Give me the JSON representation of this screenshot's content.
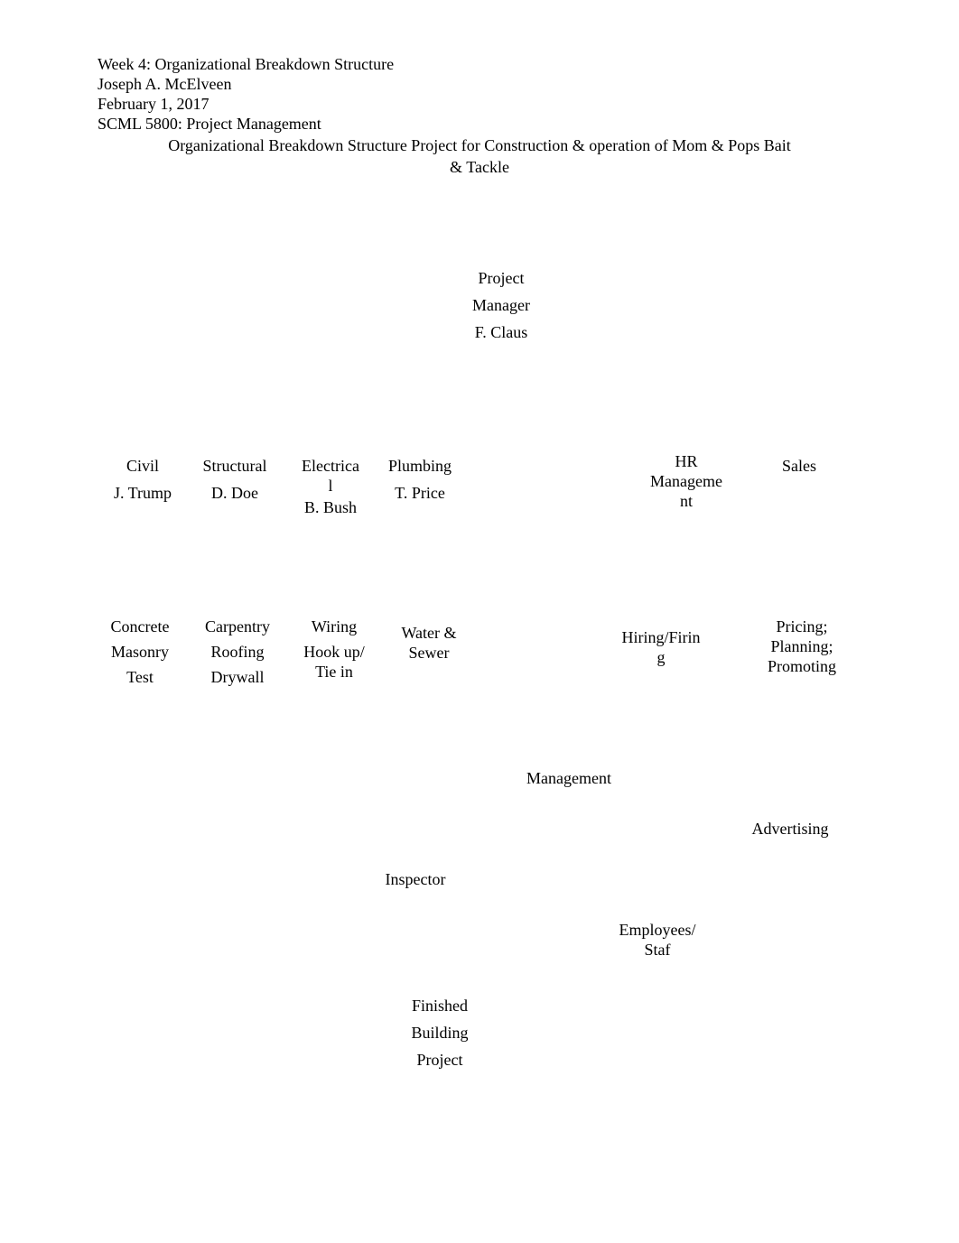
{
  "header": {
    "line1": "Week 4: Organizational Breakdown Structure",
    "line2": "Joseph A. McElveen",
    "line3": "February 1, 2017",
    "line4": "SCML 5800: Project Management",
    "title_line1": "Organizational Breakdown Structure Project for Construction & operation of Mom & Pops Bait",
    "title_line2": "& Tackle"
  },
  "chart_data": {
    "type": "org-chart",
    "root": {
      "title": "Project Manager",
      "name": "F. Claus",
      "children": [
        {
          "title": "Civil",
          "name": "J. Trump",
          "children": [
            {
              "title": "Concrete"
            },
            {
              "title": "Masonry"
            },
            {
              "title": "Test"
            }
          ]
        },
        {
          "title": "Structural",
          "name": "D. Doe",
          "children": [
            {
              "title": "Carpentry"
            },
            {
              "title": "Roofing"
            },
            {
              "title": "Drywall"
            }
          ]
        },
        {
          "title": "Electrical",
          "name": "B. Bush",
          "children": [
            {
              "title": "Wiring"
            },
            {
              "title": "Hook up/ Tie in"
            }
          ]
        },
        {
          "title": "Plumbing",
          "name": "T. Price",
          "children": [
            {
              "title": "Water & Sewer"
            }
          ]
        },
        {
          "title": "HR Management",
          "children": [
            {
              "title": "Hiring/Firing"
            },
            {
              "title": "Management"
            },
            {
              "title": "Employees/Staf"
            }
          ]
        },
        {
          "title": "Sales",
          "children": [
            {
              "title": "Pricing; Planning; Promoting"
            },
            {
              "title": "Advertising"
            }
          ]
        }
      ]
    },
    "additional_nodes": [
      {
        "title": "Inspector"
      },
      {
        "title": "Finished Building Project"
      }
    ]
  },
  "nodes": {
    "pm_l1": "Project",
    "pm_l2": "Manager",
    "pm_l3": "F. Claus",
    "civil_l1": "Civil",
    "civil_l2": "J. Trump",
    "structural_l1": "Structural",
    "structural_l2": "D. Doe",
    "electrical_l1": "Electrica",
    "electrical_l2": "l",
    "electrical_l3": "B. Bush",
    "plumbing_l1": "Plumbing",
    "plumbing_l2": "T. Price",
    "hr_l1": "HR",
    "hr_l2": "Manageme",
    "hr_l3": "nt",
    "sales_l1": "Sales",
    "civil_c1": "Concrete",
    "civil_c2": "Masonry",
    "civil_c3": "Test",
    "struct_c1": "Carpentry",
    "struct_c2": "Roofing",
    "struct_c3": "Drywall",
    "elec_c1": "Wiring",
    "elec_c2": "Hook up/",
    "elec_c3": "Tie in",
    "plumb_c1": "Water &",
    "plumb_c2": "Sewer",
    "hr_c1a": "Hiring/Firin",
    "hr_c1b": "g",
    "sales_c1": "Pricing;",
    "sales_c2": "Planning;",
    "sales_c3": "Promoting",
    "management": "Management",
    "advertising": "Advertising",
    "inspector": "Inspector",
    "emp_l1": "Employees/",
    "emp_l2": "Staf",
    "fin_l1": "Finished",
    "fin_l2": "Building",
    "fin_l3": "Project"
  }
}
